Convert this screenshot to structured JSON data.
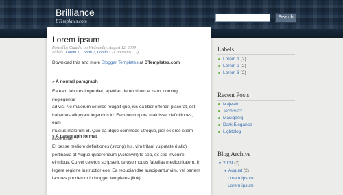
{
  "header": {
    "title": "Brilliance",
    "subtitle": "BTemplates.com",
    "search_button": "Search"
  },
  "post": {
    "title": "Lorem ipsum",
    "meta_posted": "Posted by Claudia on Wednesday, August 12, 2009",
    "meta_labels_prefix": "Labels: ",
    "meta_labels": "Lorem 1, Lorem 2, Lorem 3",
    "meta_comments": " / Comments: (2)",
    "download_prefix": "Download this and more ",
    "download_link": "Blogger Templates",
    "download_mid": " at ",
    "download_site": "BTemplates.com",
    "subhead_1": "» A normal paragraph",
    "para_1_lines": [
      "Ea eam labores imperdiet, apeirian democritum ei nam, doming neglegentur",
      "ad vis. Ne malorum ceteros feugait quo, ius ea liber offendit placerat, est",
      "habemus aliquyam legendos id. Eam no corpora maluisset definitiones, eam",
      "mucius malorum id. Quo ea idque commodo utroque, per ex eros etiam",
      "accumsan."
    ],
    "subhead_2": "» A paragraph format",
    "para_2_lines": [
      "Et pesse meliore definitiones (strong) his, vim tritani vulputate (italic)",
      "pertinacia at  Augue quaerendum (Acronym) te sea, ex sed invenire",
      "eirmibus. Cu vel ceteros scripserit, te usu modus fabellas mediocritatem. In",
      "legere regione instructior eos. Ea repudiandae suscipiantur vim, vel partem",
      "labores ponderum in blogger templates (link)."
    ]
  },
  "sidebar": {
    "labels_title": "Labels",
    "labels": [
      {
        "name": "Lorem 1",
        "count": "(2)"
      },
      {
        "name": "Lorem 2",
        "count": "(2)"
      },
      {
        "name": "Lorem 3",
        "count": "(2)"
      }
    ],
    "recent_title": "Recent Posts",
    "recent": [
      "Majestic",
      "TechBuzz",
      "Masigasig",
      "Dark Elegance",
      "Lightblog"
    ],
    "archive_title": "Blog Archive",
    "archive_year": "2009",
    "archive_year_count": "(2)",
    "archive_month": "August",
    "archive_month_count": "(2)",
    "archive_posts": [
      "Lorem ipsum",
      "Lorem ipsum"
    ]
  }
}
